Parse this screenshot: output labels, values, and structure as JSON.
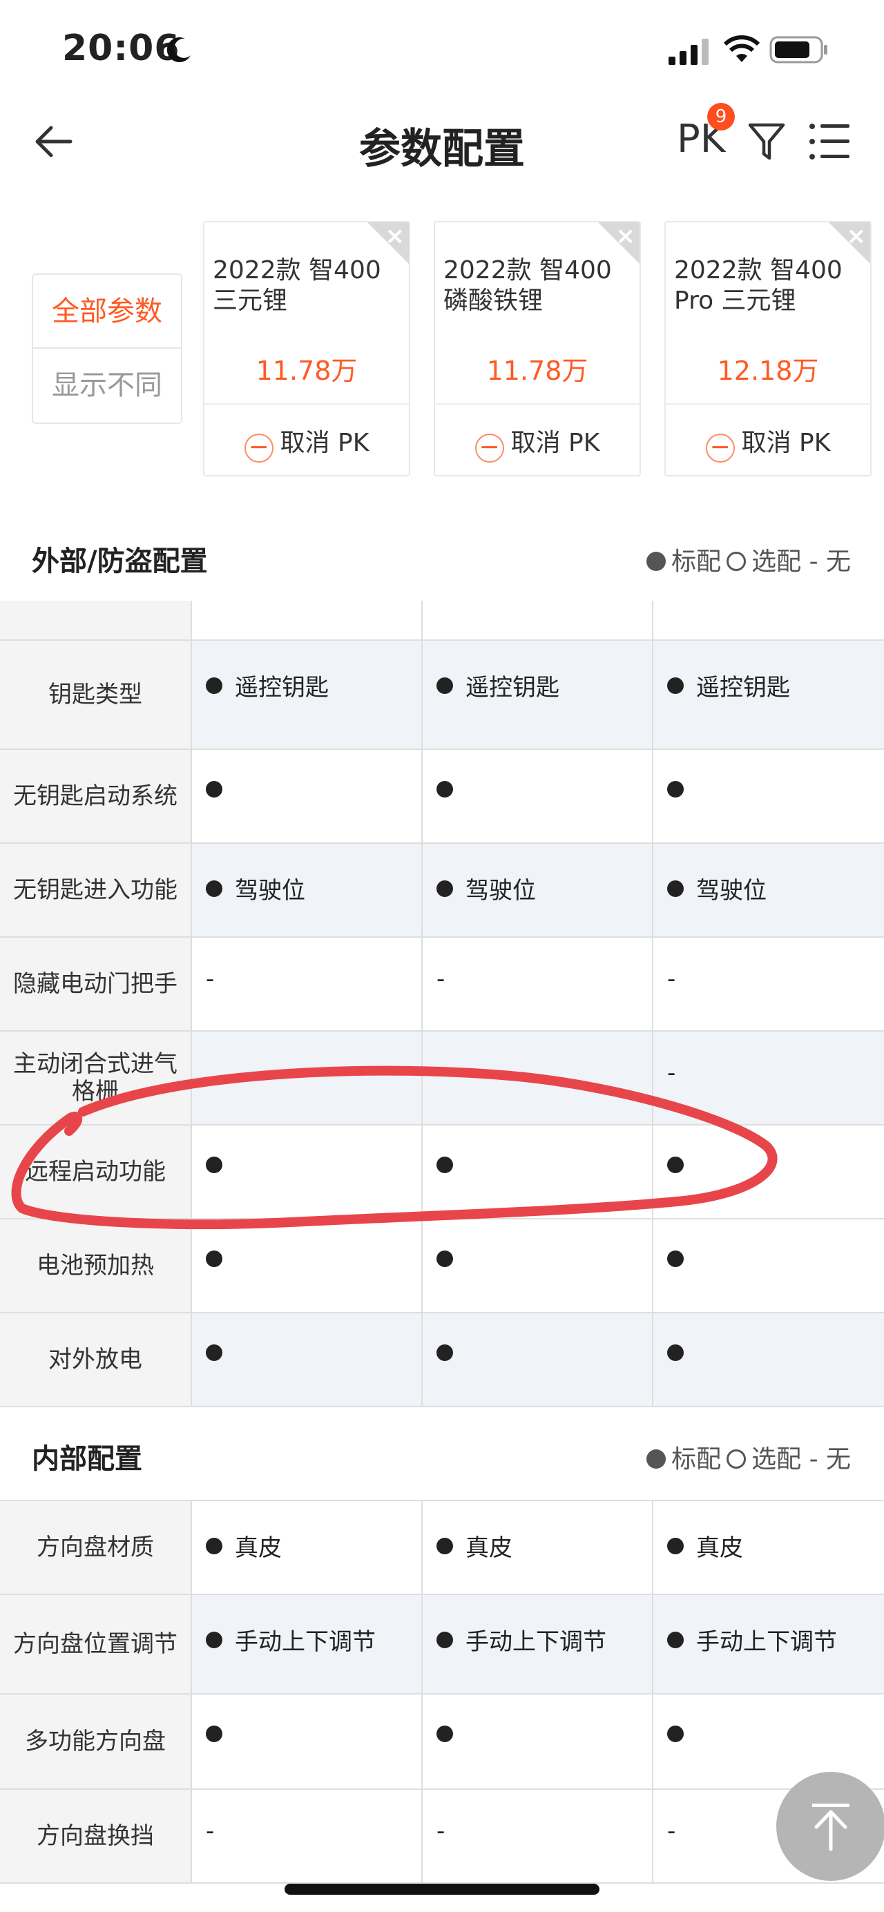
{
  "status_bar": {
    "time": "20:06"
  },
  "nav": {
    "title": "参数配置",
    "pk_label": "PK",
    "pk_badge": "9"
  },
  "modes": [
    "全部参数",
    "显示不同"
  ],
  "cars": [
    {
      "name": "2022款 智400 三元锂",
      "price": "11.78万",
      "cancel_label": "取消 PK"
    },
    {
      "name": "2022款 智400 磷酸铁锂",
      "price": "11.78万",
      "cancel_label": "取消 PK"
    },
    {
      "name": "2022款 智400 Pro 三元锂",
      "price": "12.18万",
      "cancel_label": "取消 PK"
    }
  ],
  "legend": {
    "standard": "标配",
    "optional": "选配",
    "none": "- 无"
  },
  "sections": [
    {
      "title": "外部/防盗配置",
      "rows": [
        {
          "label": "钥匙类型",
          "values": [
            "遥控钥匙",
            "遥控钥匙",
            "遥控钥匙"
          ],
          "bullet": true
        },
        {
          "label": "无钥匙启动系统",
          "values": [
            "",
            "",
            ""
          ],
          "bullet": true
        },
        {
          "label": "无钥匙进入功能",
          "values": [
            "驾驶位",
            "驾驶位",
            "驾驶位"
          ],
          "bullet": true
        },
        {
          "label": "隐藏电动门把手",
          "values": [
            "-",
            "-",
            "-"
          ],
          "bullet": false
        },
        {
          "label": "主动闭合式进气格栅",
          "values": [
            "",
            "-",
            "-"
          ],
          "bullet": false
        },
        {
          "label": "远程启动功能",
          "values": [
            "",
            "",
            ""
          ],
          "bullet": true
        },
        {
          "label": "电池预加热",
          "values": [
            "",
            "",
            ""
          ],
          "bullet": true
        },
        {
          "label": "对外放电",
          "values": [
            "",
            "",
            ""
          ],
          "bullet": true
        }
      ]
    },
    {
      "title": "内部配置",
      "rows": [
        {
          "label": "方向盘材质",
          "values": [
            "真皮",
            "真皮",
            "真皮"
          ],
          "bullet": true
        },
        {
          "label": "方向盘位置调节",
          "values": [
            "手动上下调节",
            "手动上下调节",
            "手动上下调节"
          ],
          "bullet": true
        },
        {
          "label": "多功能方向盘",
          "values": [
            "",
            "",
            ""
          ],
          "bullet": true
        },
        {
          "label": "方向盘换挡",
          "values": [
            "-",
            "-",
            "-"
          ],
          "bullet": false
        }
      ]
    }
  ],
  "colors": {
    "accent": "#ff5a23",
    "annotation": "#e8454a"
  }
}
